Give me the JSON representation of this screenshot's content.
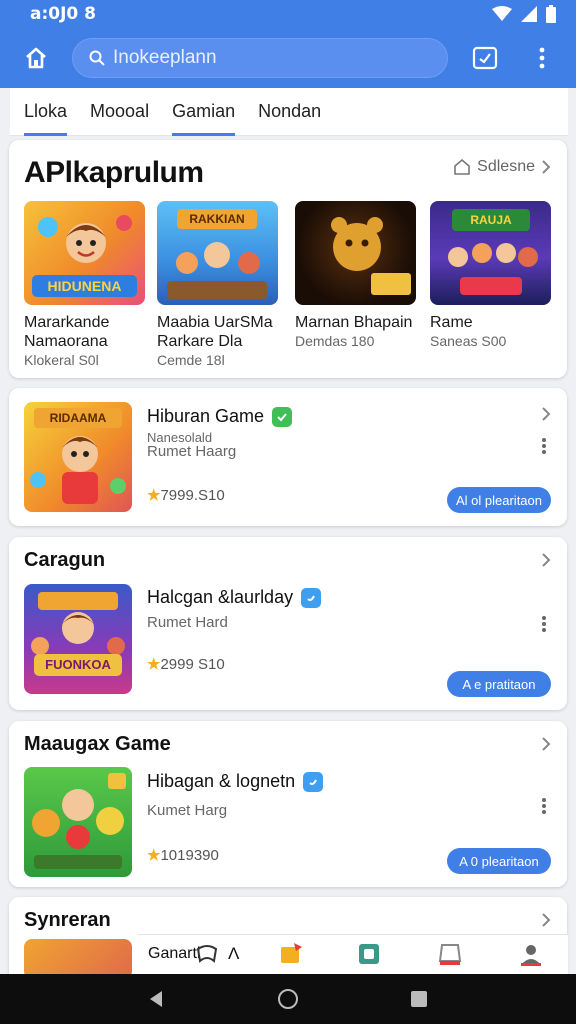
{
  "status": {
    "time": "a:0J0 8"
  },
  "search": {
    "placeholder": "Inokeeplann"
  },
  "tabs": [
    {
      "label": "Lloka",
      "active": true
    },
    {
      "label": "Moooal",
      "active": false
    },
    {
      "label": "Gamian",
      "active": true
    },
    {
      "label": "Nondan",
      "active": false
    }
  ],
  "featured": {
    "title": "APlkaprulum",
    "see_all": "Sdlesne",
    "games": [
      {
        "name": "Mararkande",
        "name2": "Namaorana",
        "sub": "Klokeral S0l",
        "art_text": "HIDUNENA"
      },
      {
        "name": "Maabia UarSMa",
        "name2": "Rarkare Dla",
        "sub": "Cemde 18l",
        "art_text": "RAKKIAN"
      },
      {
        "name": "Marnan Bhapain",
        "name2": "",
        "sub": "Demdas 180",
        "art_text": ""
      },
      {
        "name": "Rame",
        "name2": "",
        "sub": "Saneas S00",
        "art_text": "RAUJA"
      }
    ]
  },
  "sections": [
    {
      "title": "",
      "app_name": "Hiburan Game",
      "meta1": "Nanesolald",
      "meta2": "Rumet Haarg",
      "rating": "★7999.S10",
      "install": "Al ol plearitaon",
      "art_text": "RIDAAMA"
    },
    {
      "title": "Caragun",
      "app_name": "Halcgan &laurlday",
      "meta1": "Rumet Hard",
      "meta2": "",
      "rating": "★2999 S10",
      "install": "A e pratitaon",
      "art_text": "FUONKOA"
    },
    {
      "title": "Maaugax Game",
      "app_name": "Hibagan & lognetn",
      "meta1": "Kumet Harg",
      "meta2": "",
      "rating": "★1019390",
      "install": "A 0 plearitaon",
      "art_text": ""
    }
  ],
  "last_section": {
    "title": "Synreran",
    "item_label": "Ganartl",
    "item_label2": "Λ"
  },
  "colors": {
    "accent": "#3f7fe6",
    "rating": "#f2b01e",
    "badge_green": "#3fbf55",
    "badge_blue": "#3f9ef0"
  }
}
